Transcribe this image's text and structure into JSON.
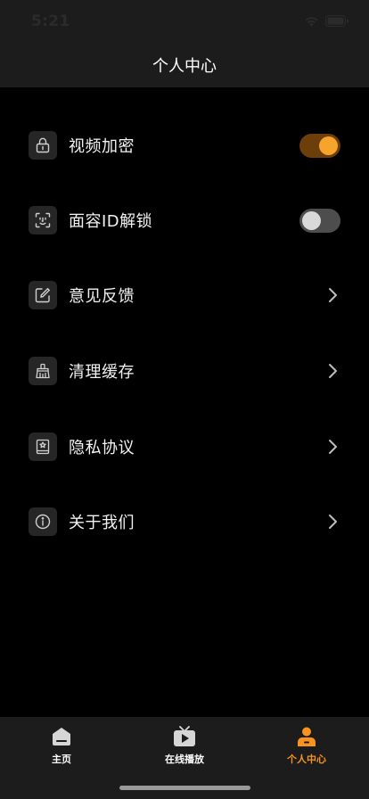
{
  "status_bar": {
    "time": "5:21"
  },
  "header": {
    "title": "个人中心"
  },
  "menu": [
    {
      "label": "视频加密",
      "icon": "lock-icon",
      "control": "toggle",
      "toggle_on": true
    },
    {
      "label": "面容ID解锁",
      "icon": "face-id-icon",
      "control": "toggle",
      "toggle_on": false
    },
    {
      "label": "意见反馈",
      "icon": "edit-icon",
      "control": "chevron"
    },
    {
      "label": "清理缓存",
      "icon": "broom-icon",
      "control": "chevron"
    },
    {
      "label": "隐私协议",
      "icon": "shield-book-icon",
      "control": "chevron"
    },
    {
      "label": "关于我们",
      "icon": "info-icon",
      "control": "chevron"
    }
  ],
  "tabs": [
    {
      "label": "主页",
      "icon": "home-icon",
      "active": false
    },
    {
      "label": "在线播放",
      "icon": "tv-play-icon",
      "active": false
    },
    {
      "label": "个人中心",
      "icon": "person-icon",
      "active": true
    }
  ],
  "colors": {
    "accent": "#f7931e",
    "toggle_on_track": "#6b3e0a",
    "toggle_on_knob": "#f7a42d",
    "toggle_off_track": "#4d4d4d",
    "background": "#000000",
    "bar_background": "#1c1c1c"
  }
}
